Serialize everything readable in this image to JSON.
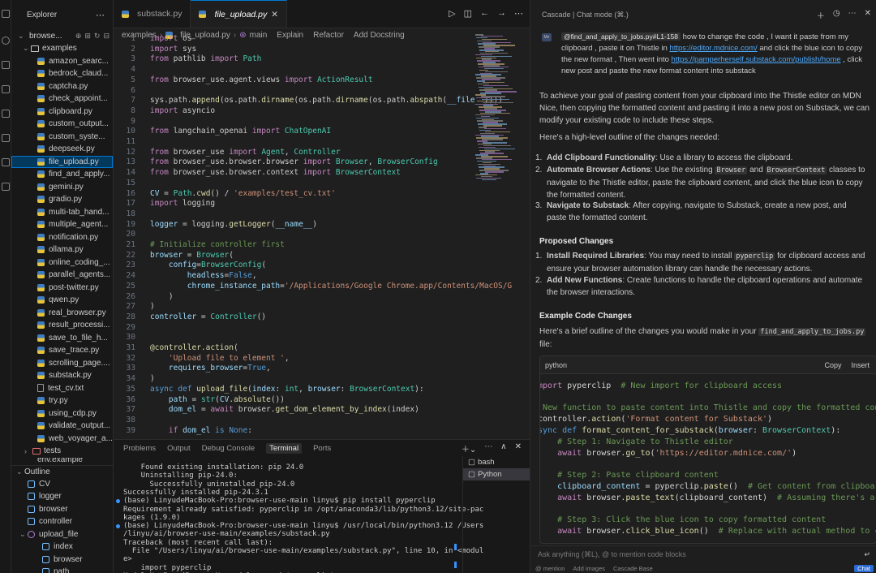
{
  "sidebar": {
    "title": "Explorer",
    "root_label": "browse...",
    "examples_folder": "examples",
    "files": [
      "amazon_searc...",
      "bedrock_claud...",
      "captcha.py",
      "check_appoint...",
      "clipboard.py",
      "custom_output...",
      "custom_syste...",
      "deepseek.py",
      "file_upload.py",
      "find_and_apply...",
      "gemini.py",
      "gradio.py",
      "multi-tab_hand...",
      "multiple_agent...",
      "notification.py",
      "ollama.py",
      "online_coding_...",
      "parallel_agents...",
      "post-twitter.py",
      "qwen.py",
      "real_browser.py",
      "result_processi...",
      "save_to_file_h...",
      "save_trace.py",
      "scrolling_page....",
      "substack.py",
      "test_cv.txt",
      "try.py",
      "using_cdp.py",
      "validate_output...",
      "web_voyager_a..."
    ],
    "selected_file": "file_upload.py",
    "tests_folder": "tests",
    "env_folder": "env.example",
    "outline": {
      "title": "Outline",
      "items": [
        {
          "label": "CV",
          "kind": "var",
          "indent": 1
        },
        {
          "label": "logger",
          "kind": "var",
          "indent": 1
        },
        {
          "label": "browser",
          "kind": "var",
          "indent": 1
        },
        {
          "label": "controller",
          "kind": "var",
          "indent": 1
        },
        {
          "label": "upload_file",
          "kind": "func",
          "indent": 1
        },
        {
          "label": "index",
          "kind": "var",
          "indent": 2
        },
        {
          "label": "browser",
          "kind": "var",
          "indent": 2
        },
        {
          "label": "path",
          "kind": "var",
          "indent": 2
        }
      ]
    }
  },
  "editor": {
    "tabs": [
      {
        "label": "substack.py",
        "active": false
      },
      {
        "label": "file_upload.py",
        "active": true
      }
    ],
    "breadcrumb": [
      "examples",
      "file_upload.py",
      "main"
    ],
    "code_lens": [
      "Explain",
      "Refactor",
      "Add Docstring"
    ],
    "lines": [
      {
        "n": "1",
        "html": "<span class='kw'>import</span> os"
      },
      {
        "n": "2",
        "html": "<span class='kw'>import</span> sys"
      },
      {
        "n": "3",
        "html": "<span class='kw'>from</span> pathlib <span class='kw'>import</span> <span class='cls'>Path</span>"
      },
      {
        "n": "4",
        "html": ""
      },
      {
        "n": "5",
        "html": "<span class='kw'>from</span> browser_use.agent.views <span class='kw'>import</span> <span class='cls'>ActionResult</span>"
      },
      {
        "n": "6",
        "html": ""
      },
      {
        "n": "7",
        "html": "sys.path.<span class='fn'>append</span>(os.path.<span class='fn'>dirname</span>(os.path.<span class='fn'>dirname</span>(os.path.<span class='fn'>abspath</span>(<span class='var'>__file__</span>))))"
      },
      {
        "n": "8",
        "html": "<span class='kw'>import</span> asyncio"
      },
      {
        "n": "9",
        "html": ""
      },
      {
        "n": "10",
        "html": "<span class='kw'>from</span> langchain_openai <span class='kw'>import</span> <span class='cls'>ChatOpenAI</span>"
      },
      {
        "n": "11",
        "html": ""
      },
      {
        "n": "12",
        "html": "<span class='kw'>from</span> browser_use <span class='kw'>import</span> <span class='cls'>Agent</span>, <span class='cls'>Controller</span>"
      },
      {
        "n": "13",
        "html": "<span class='kw'>from</span> browser_use.browser.browser <span class='kw'>import</span> <span class='cls'>Browser</span>, <span class='cls'>BrowserConfig</span>"
      },
      {
        "n": "14",
        "html": "<span class='kw'>from</span> browser_use.browser.context <span class='kw'>import</span> <span class='cls'>BrowserContext</span>"
      },
      {
        "n": "15",
        "html": ""
      },
      {
        "n": "16",
        "html": "<span class='var'>CV</span> = <span class='cls'>Path</span>.<span class='fn'>cwd</span>() / <span class='str'>'examples/test_cv.txt'</span>"
      },
      {
        "n": "17",
        "html": "<span class='kw'>import</span> logging"
      },
      {
        "n": "18",
        "html": ""
      },
      {
        "n": "19",
        "html": "<span class='var'>logger</span> = logging.<span class='fn'>getLogger</span>(<span class='var'>__name__</span>)"
      },
      {
        "n": "20",
        "html": ""
      },
      {
        "n": "21",
        "html": "<span class='cmt'># Initialize controller first</span>"
      },
      {
        "n": "22",
        "html": "<span class='var'>browser</span> = <span class='cls'>Browser</span>("
      },
      {
        "n": "23",
        "html": "    <span class='var'>config</span>=<span class='cls'>BrowserConfig</span>("
      },
      {
        "n": "24",
        "html": "        <span class='var'>headless</span>=<span class='kw2'>False</span>,"
      },
      {
        "n": "25",
        "html": "        <span class='var'>chrome_instance_path</span>=<span class='str'>'/Applications/Google Chrome.app/Contents/MacOS/G</span>"
      },
      {
        "n": "26",
        "html": "    )"
      },
      {
        "n": "27",
        "html": ")"
      },
      {
        "n": "28",
        "html": "<span class='var'>controller</span> = <span class='cls'>Controller</span>()"
      },
      {
        "n": "29",
        "html": ""
      },
      {
        "n": "30",
        "html": ""
      },
      {
        "n": "31",
        "html": "<span class='fn'>@controller.action</span>("
      },
      {
        "n": "32",
        "html": "    <span class='str'>'Upload file to element '</span>,"
      },
      {
        "n": "33",
        "html": "    <span class='var'>requires_browser</span>=<span class='kw2'>True</span>,"
      },
      {
        "n": "34",
        "html": ")"
      },
      {
        "n": "35",
        "html": "<span class='kw2'>async</span> <span class='kw2'>def</span> <span class='fn'>upload_file</span>(<span class='var'>index</span>: <span class='cls'>int</span>, <span class='var'>browser</span>: <span class='cls'>BrowserContext</span>):"
      },
      {
        "n": "36",
        "html": "    <span class='var'>path</span> = <span class='cls'>str</span>(<span class='var'>CV</span>.<span class='fn'>absolute</span>())"
      },
      {
        "n": "37",
        "html": "    <span class='var'>dom_el</span> = <span class='kw'>await</span> browser.<span class='fn'>get_dom_element_by_index</span>(index)"
      },
      {
        "n": "38",
        "html": ""
      },
      {
        "n": "39",
        "html": "    <span class='kw'>if</span> <span class='var'>dom_el</span> <span class='kw2'>is</span> <span class='kw2'>None</span>:"
      }
    ]
  },
  "panel": {
    "tabs": [
      "Problems",
      "Output",
      "Debug Console",
      "Terminal",
      "Ports"
    ],
    "active_tab": "Terminal",
    "terminals": [
      "bash",
      "Python"
    ],
    "active_terminal": "Python",
    "lines": [
      {
        "t": "    Found existing installation: pip 24.0",
        "dot": false
      },
      {
        "t": "    Uninstalling pip-24.0:",
        "dot": false
      },
      {
        "t": "      Successfully uninstalled pip-24.0",
        "dot": false
      },
      {
        "t": "Successfully installed pip-24.3.1",
        "dot": false
      },
      {
        "t": "(base) LinyudeMacBook-Pro:browser-use-main linyu$ pip install pyperclip",
        "dot": true
      },
      {
        "t": "Requirement already satisfied: pyperclip in /opt/anaconda3/lib/python3.12/site-pac",
        "dot": false
      },
      {
        "t": "kages (1.9.0)",
        "dot": false
      },
      {
        "t": "(base) LinyudeMacBook-Pro:browser-use-main linyu$ /usr/local/bin/python3.12 /Users",
        "dot": true
      },
      {
        "t": "/linyu/ai/browser-use-main/examples/substack.py",
        "dot": false
      },
      {
        "t": "Traceback (most recent call last):",
        "dot": false
      },
      {
        "t": "  File \"/Users/linyu/ai/browser-use-main/examples/substack.py\", line 10, in <modul",
        "dot": false
      },
      {
        "t": "e>",
        "dot": false
      },
      {
        "t": "    import pyperclip",
        "dot": false
      },
      {
        "t": "ModuleNotFoundError: No module named 'pyperclip'",
        "dot": false
      }
    ]
  },
  "chat": {
    "header": "Cascade | Chat mode (⌘.)",
    "avatar": "Me",
    "user_message": {
      "chip": "@find_and_apply_to_jobs.py#L1-158",
      "part1": " how to change the code ,  I want it paste from my clipboard , paste it on Thistle in ",
      "link1": "https://editor.mdnice.com/",
      "part2": "  and click the blue icon to copy the new format , Then went into ",
      "link2": "https://pamperherself.substack.com/publish/home",
      "part3": " , click new post and paste the new format content into substack"
    },
    "intro": "To achieve your goal of pasting content from your clipboard into the Thistle editor on MDN Nice, then copying the formatted content and pasting it into a new post on Substack, we can modify your existing code to include these steps.",
    "outline_intro": "Here's a high-level outline of the changes needed:",
    "steps": [
      {
        "title": "Add Clipboard Functionality",
        "text": ": Use a library to access the clipboard."
      },
      {
        "title": "Automate Browser Actions",
        "text_a": ": Use the existing ",
        "code_a": "Browser",
        "text_b": " and ",
        "code_b": "BrowserContext",
        "text_c": " classes to navigate to the Thistle editor, paste the clipboard content, and click the blue icon to copy the formatted content."
      },
      {
        "title": "Navigate to Substack",
        "text": ": After copying, navigate to Substack, create a new post, and paste the formatted content."
      }
    ],
    "proposed_title": "Proposed Changes",
    "proposed": [
      {
        "title": "Install Required Libraries",
        "text_a": ": You may need to install ",
        "code": "pyperclip",
        "text_b": " for clipboard access and ensure your browser automation library can handle the necessary actions."
      },
      {
        "title": "Add New Functions",
        "text": ": Create functions to handle the clipboard operations and automate the browser interactions."
      }
    ],
    "example_title": "Example Code Changes",
    "example_intro_a": "Here's a brief outline of the changes you would make in your ",
    "example_code_file": "find_and_apply_to_jobs.py",
    "example_intro_b": " file:",
    "code_block": {
      "language": "python",
      "copy_label": "Copy",
      "insert_label": "Insert"
    },
    "input_placeholder": "Ask anything (⌘L), @ to mention code blocks",
    "footer": [
      "@ mention",
      "Add images",
      "Cascade Base"
    ],
    "send_label": "Chat"
  }
}
